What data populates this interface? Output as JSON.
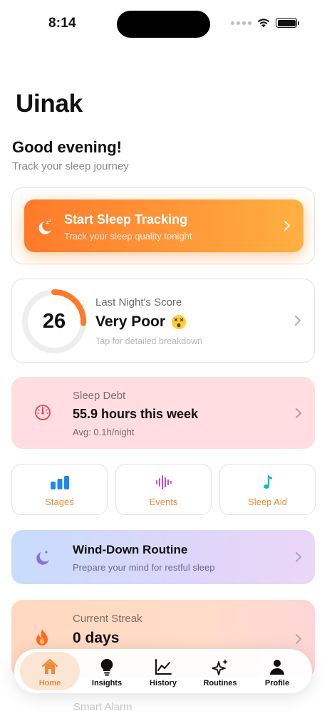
{
  "status_bar": {
    "time": "8:14"
  },
  "app": {
    "title": "Uinak"
  },
  "header": {
    "greeting": "Good evening!",
    "subtitle": "Track your sleep journey"
  },
  "start_tracking": {
    "title": "Start Sleep Tracking",
    "subtitle": "Track your sleep quality tonight",
    "icon": "moon-zzz-icon"
  },
  "score": {
    "value": "26",
    "label": "Last Night's Score",
    "rating": "Very Poor",
    "rating_emoji": "dizzy-face-icon",
    "hint": "Tap for detailed breakdown",
    "progress": 0.26,
    "accent": "#ff7a2a"
  },
  "sleep_debt": {
    "label": "Sleep Debt",
    "value": "55.9 hours this week",
    "average": "Avg: 0.1h/night",
    "icon": "gauge-icon",
    "color": "#e8454f"
  },
  "tiles": [
    {
      "label": "Stages",
      "icon": "bar-chart-icon"
    },
    {
      "label": "Events",
      "icon": "waveform-icon"
    },
    {
      "label": "Sleep Aid",
      "icon": "music-note-icon"
    }
  ],
  "wind_down": {
    "title": "Wind-Down Routine",
    "subtitle": "Prepare your mind for restful sleep",
    "icon": "moon-stars-icon"
  },
  "streak": {
    "label": "Current Streak",
    "value": "0 days",
    "icon": "flame-icon"
  },
  "smart_alarm": {
    "label": "Smart Alarm"
  },
  "tabbar": {
    "items": [
      {
        "label": "Home",
        "icon": "house-icon",
        "active": true
      },
      {
        "label": "Insights",
        "icon": "lightbulb-icon",
        "active": false
      },
      {
        "label": "History",
        "icon": "line-chart-icon",
        "active": false
      },
      {
        "label": "Routines",
        "icon": "sparkles-icon",
        "active": false
      },
      {
        "label": "Profile",
        "icon": "person-icon",
        "active": false
      }
    ]
  },
  "colors": {
    "accent": "#f08a3a",
    "debt_bg": "#ffdde0"
  }
}
